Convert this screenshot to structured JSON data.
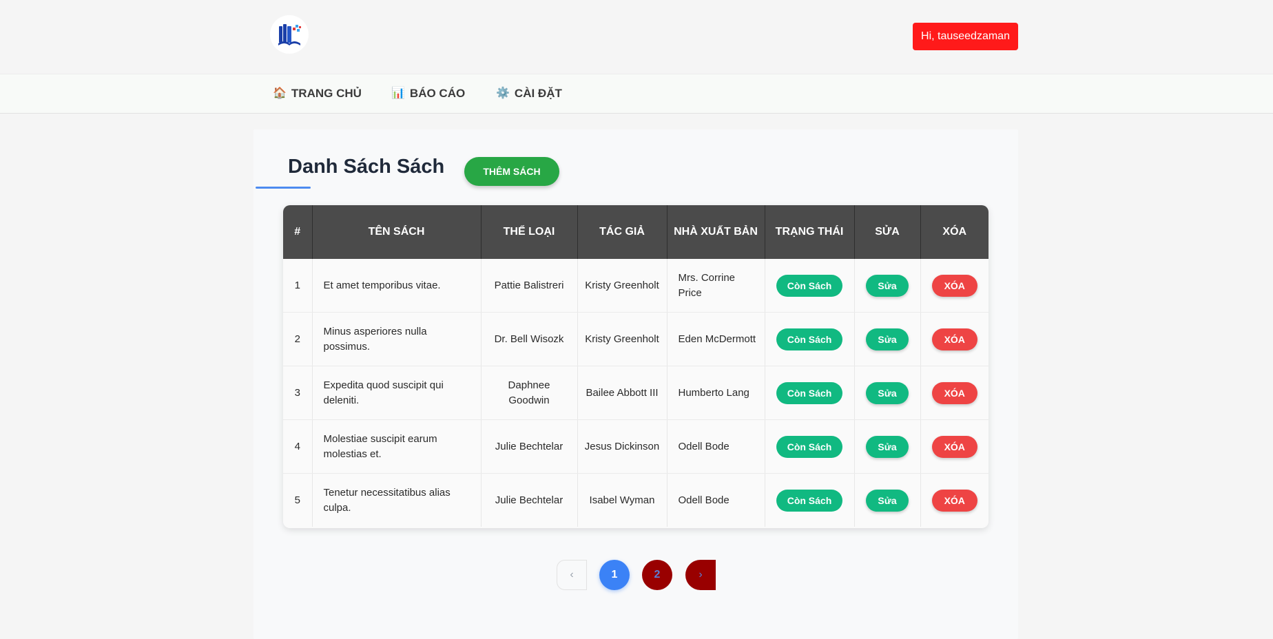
{
  "header": {
    "user_greeting": "Hi, tauseedzaman"
  },
  "nav": {
    "items": [
      {
        "icon": "home-icon",
        "label": "TRANG CHỦ"
      },
      {
        "icon": "chart-icon",
        "label": "BÁO CÁO"
      },
      {
        "icon": "gear-icon",
        "label": "CÀI ĐẶT"
      }
    ]
  },
  "main": {
    "title": "Danh Sách Sách",
    "add_button": "THÊM SÁCH"
  },
  "table": {
    "columns": [
      "#",
      "TÊN SÁCH",
      "THỂ LOẠI",
      "TÁC GIẢ",
      "NHÀ XUẤT BẢN",
      "TRẠNG THÁI",
      "SỬA",
      "XÓA"
    ],
    "rows": [
      {
        "num": "1",
        "title": "Et amet temporibus vitae.",
        "category": "Pattie Balistreri",
        "author": "Kristy Greenholt",
        "publisher": "Mrs. Corrine Price",
        "status": "Còn Sách",
        "edit": "Sửa",
        "delete": "XÓA"
      },
      {
        "num": "2",
        "title": "Minus asperiores nulla possimus.",
        "category": "Dr. Bell Wisozk",
        "author": "Kristy Greenholt",
        "publisher": "Eden McDermott",
        "status": "Còn Sách",
        "edit": "Sửa",
        "delete": "XÓA"
      },
      {
        "num": "3",
        "title": "Expedita quod suscipit qui deleniti.",
        "category": "Daphnee Goodwin",
        "author": "Bailee Abbott III",
        "publisher": "Humberto Lang",
        "status": "Còn Sách",
        "edit": "Sửa",
        "delete": "XÓA"
      },
      {
        "num": "4",
        "title": "Molestiae suscipit earum molestias et.",
        "category": "Julie Bechtelar",
        "author": "Jesus Dickinson",
        "publisher": "Odell Bode",
        "status": "Còn Sách",
        "edit": "Sửa",
        "delete": "XÓA"
      },
      {
        "num": "5",
        "title": "Tenetur necessitatibus alias culpa.",
        "category": "Julie Bechtelar",
        "author": "Isabel Wyman",
        "publisher": "Odell Bode",
        "status": "Còn Sách",
        "edit": "Sửa",
        "delete": "XÓA"
      }
    ]
  },
  "pagination": {
    "prev": "‹",
    "pages": [
      "1",
      "2"
    ],
    "current_page": "1",
    "next": "›"
  },
  "colors": {
    "accent": "#3b82f6",
    "add_button": "#28a745",
    "status_badge": "#11b981",
    "delete_button": "#ee4444",
    "user_button": "#ff1a1a",
    "table_header": "#4b4b4b"
  }
}
